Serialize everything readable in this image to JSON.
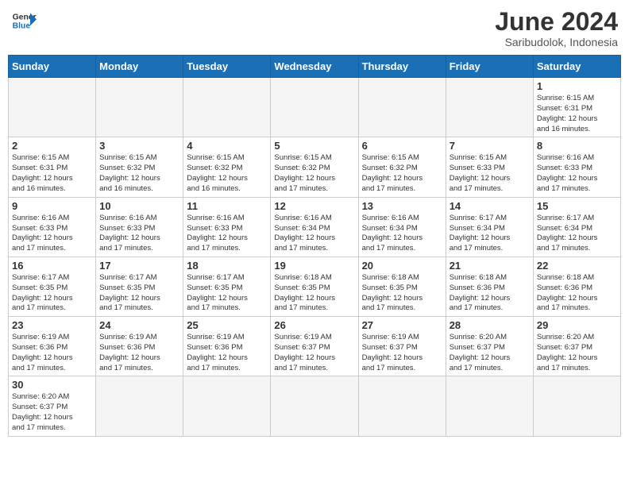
{
  "header": {
    "logo_general": "General",
    "logo_blue": "Blue",
    "title": "June 2024",
    "subtitle": "Saribudolok, Indonesia"
  },
  "weekdays": [
    "Sunday",
    "Monday",
    "Tuesday",
    "Wednesday",
    "Thursday",
    "Friday",
    "Saturday"
  ],
  "days": [
    {
      "date": "1",
      "empty": false,
      "col": 6,
      "sunrise": "6:15 AM",
      "sunset": "6:31 PM",
      "daylight": "12 hours and 16 minutes."
    },
    {
      "date": "2",
      "sunrise": "6:15 AM",
      "sunset": "6:31 PM",
      "daylight": "12 hours and 16 minutes."
    },
    {
      "date": "3",
      "sunrise": "6:15 AM",
      "sunset": "6:32 PM",
      "daylight": "12 hours and 16 minutes."
    },
    {
      "date": "4",
      "sunrise": "6:15 AM",
      "sunset": "6:32 PM",
      "daylight": "12 hours and 16 minutes."
    },
    {
      "date": "5",
      "sunrise": "6:15 AM",
      "sunset": "6:32 PM",
      "daylight": "12 hours and 17 minutes."
    },
    {
      "date": "6",
      "sunrise": "6:15 AM",
      "sunset": "6:32 PM",
      "daylight": "12 hours and 17 minutes."
    },
    {
      "date": "7",
      "sunrise": "6:15 AM",
      "sunset": "6:33 PM",
      "daylight": "12 hours and 17 minutes."
    },
    {
      "date": "8",
      "sunrise": "6:16 AM",
      "sunset": "6:33 PM",
      "daylight": "12 hours and 17 minutes."
    },
    {
      "date": "9",
      "sunrise": "6:16 AM",
      "sunset": "6:33 PM",
      "daylight": "12 hours and 17 minutes."
    },
    {
      "date": "10",
      "sunrise": "6:16 AM",
      "sunset": "6:33 PM",
      "daylight": "12 hours and 17 minutes."
    },
    {
      "date": "11",
      "sunrise": "6:16 AM",
      "sunset": "6:33 PM",
      "daylight": "12 hours and 17 minutes."
    },
    {
      "date": "12",
      "sunrise": "6:16 AM",
      "sunset": "6:34 PM",
      "daylight": "12 hours and 17 minutes."
    },
    {
      "date": "13",
      "sunrise": "6:16 AM",
      "sunset": "6:34 PM",
      "daylight": "12 hours and 17 minutes."
    },
    {
      "date": "14",
      "sunrise": "6:17 AM",
      "sunset": "6:34 PM",
      "daylight": "12 hours and 17 minutes."
    },
    {
      "date": "15",
      "sunrise": "6:17 AM",
      "sunset": "6:34 PM",
      "daylight": "12 hours and 17 minutes."
    },
    {
      "date": "16",
      "sunrise": "6:17 AM",
      "sunset": "6:35 PM",
      "daylight": "12 hours and 17 minutes."
    },
    {
      "date": "17",
      "sunrise": "6:17 AM",
      "sunset": "6:35 PM",
      "daylight": "12 hours and 17 minutes."
    },
    {
      "date": "18",
      "sunrise": "6:17 AM",
      "sunset": "6:35 PM",
      "daylight": "12 hours and 17 minutes."
    },
    {
      "date": "19",
      "sunrise": "6:18 AM",
      "sunset": "6:35 PM",
      "daylight": "12 hours and 17 minutes."
    },
    {
      "date": "20",
      "sunrise": "6:18 AM",
      "sunset": "6:35 PM",
      "daylight": "12 hours and 17 minutes."
    },
    {
      "date": "21",
      "sunrise": "6:18 AM",
      "sunset": "6:36 PM",
      "daylight": "12 hours and 17 minutes."
    },
    {
      "date": "22",
      "sunrise": "6:18 AM",
      "sunset": "6:36 PM",
      "daylight": "12 hours and 17 minutes."
    },
    {
      "date": "23",
      "sunrise": "6:19 AM",
      "sunset": "6:36 PM",
      "daylight": "12 hours and 17 minutes."
    },
    {
      "date": "24",
      "sunrise": "6:19 AM",
      "sunset": "6:36 PM",
      "daylight": "12 hours and 17 minutes."
    },
    {
      "date": "25",
      "sunrise": "6:19 AM",
      "sunset": "6:36 PM",
      "daylight": "12 hours and 17 minutes."
    },
    {
      "date": "26",
      "sunrise": "6:19 AM",
      "sunset": "6:37 PM",
      "daylight": "12 hours and 17 minutes."
    },
    {
      "date": "27",
      "sunrise": "6:19 AM",
      "sunset": "6:37 PM",
      "daylight": "12 hours and 17 minutes."
    },
    {
      "date": "28",
      "sunrise": "6:20 AM",
      "sunset": "6:37 PM",
      "daylight": "12 hours and 17 minutes."
    },
    {
      "date": "29",
      "sunrise": "6:20 AM",
      "sunset": "6:37 PM",
      "daylight": "12 hours and 17 minutes."
    },
    {
      "date": "30",
      "sunrise": "6:20 AM",
      "sunset": "6:37 PM",
      "daylight": "12 hours and 17 minutes."
    }
  ],
  "labels": {
    "sunrise": "Sunrise:",
    "sunset": "Sunset:",
    "daylight": "Daylight:"
  }
}
